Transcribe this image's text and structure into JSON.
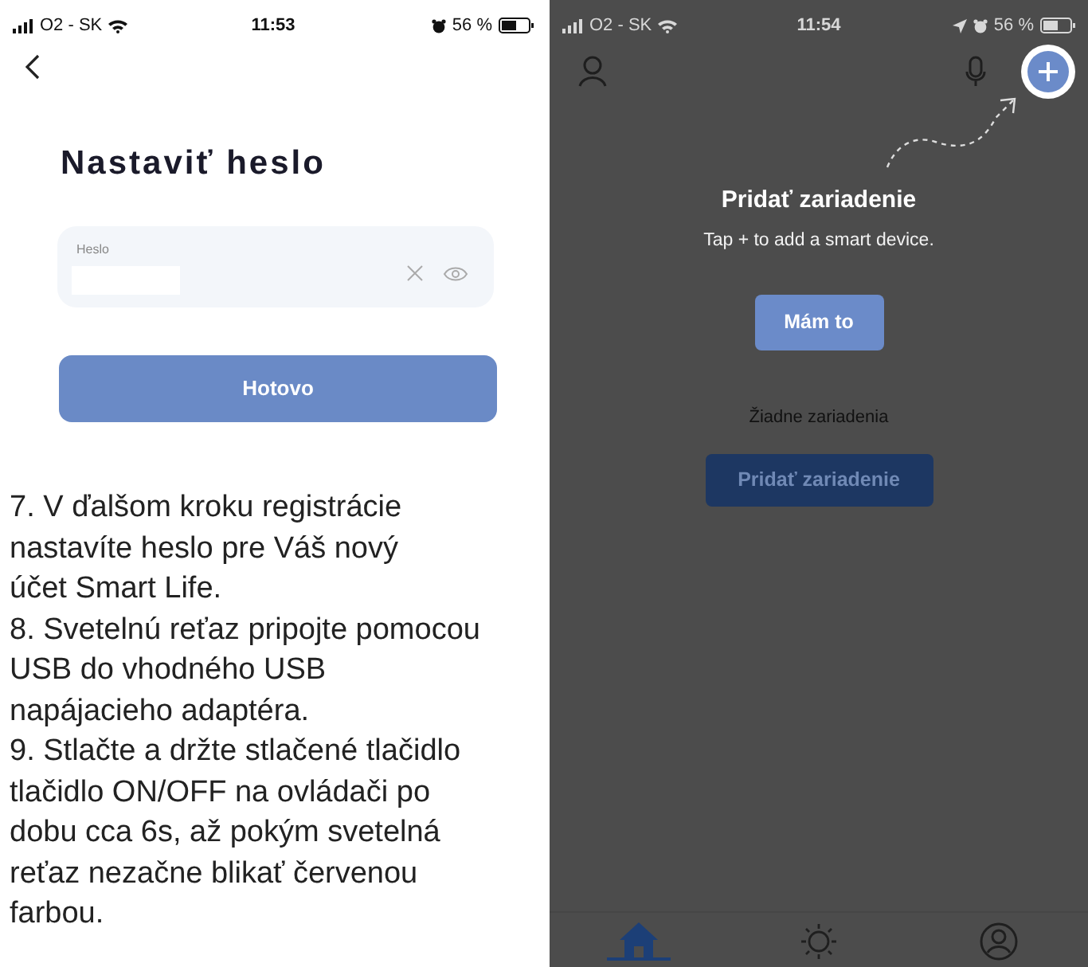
{
  "left_screen": {
    "status_bar": {
      "carrier": "O2 - SK",
      "time": "11:53",
      "battery": "56 %",
      "location": false
    },
    "title": "Nastaviť heslo",
    "password_field": {
      "label": "Heslo"
    },
    "done_button": "Hotovo"
  },
  "instructions": [
    "7. V ďalšom kroku registrácie\nnastavíte heslo pre Váš nový\núčet Smart Life.",
    "8. Svetelnú reťaz pripojte pomocou\nUSB do vhodného USB\nnapájacieho adaptéra.",
    "9. Stlačte a držte stlačené tlačidlo\ntlačidlo ON/OFF na ovládači po\ndobu cca 6s, až pokým svetelná\nreťaz nezačne blikať červenou\nfarbou."
  ],
  "right_screen": {
    "status_bar": {
      "carrier": "O2 - SK",
      "time": "11:54",
      "battery": "56 %",
      "location": true
    },
    "coach_mark": {
      "title": "Pridať zariadenie",
      "hint": "Tap + to add a smart device.",
      "button": "Mám to"
    },
    "empty_state": {
      "message": "Žiadne zariadenia",
      "button": "Pridať zariadenie"
    },
    "tab_bar": [
      {
        "kind": "home",
        "selected": true
      },
      {
        "kind": "scenes",
        "selected": false
      },
      {
        "kind": "profile",
        "selected": false
      }
    ]
  }
}
